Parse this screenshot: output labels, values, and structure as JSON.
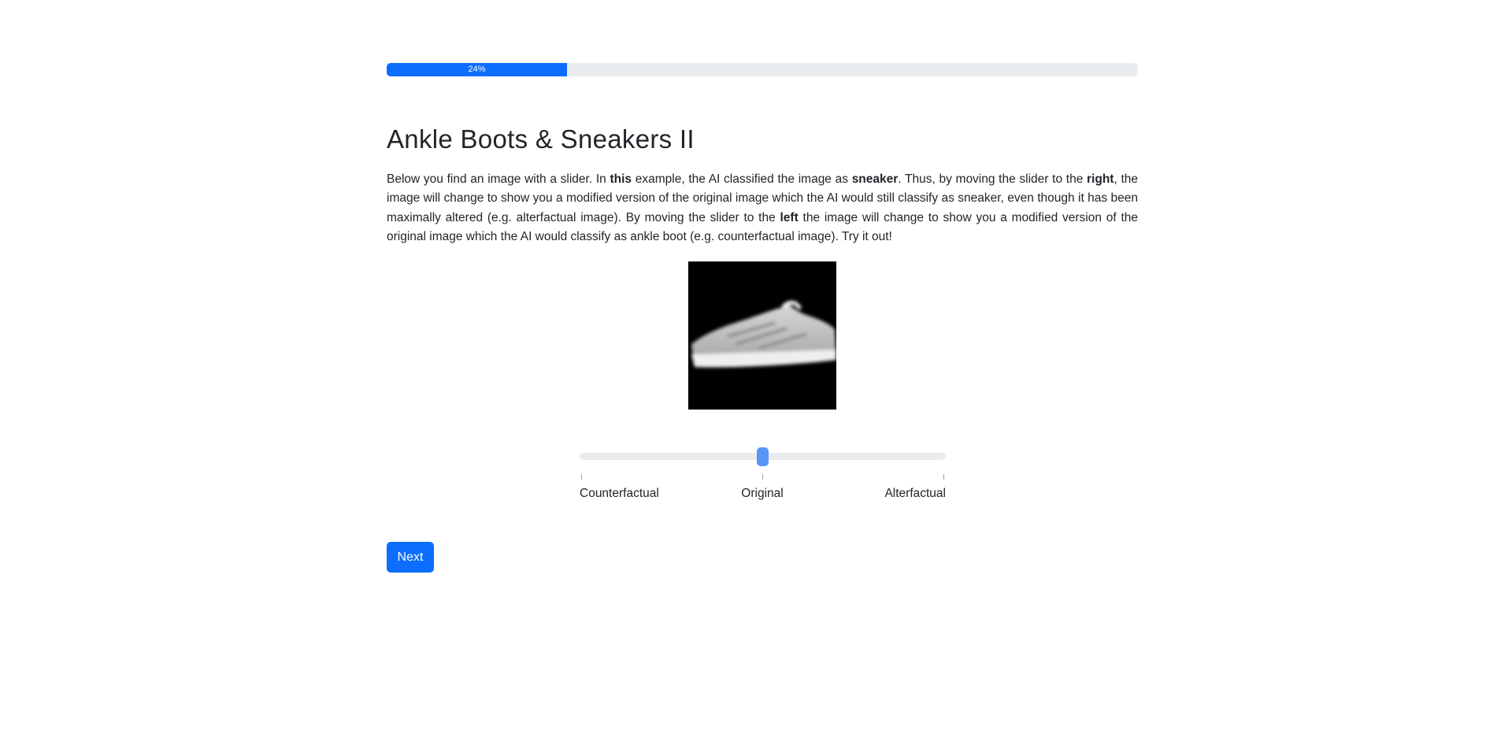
{
  "progress": {
    "value": 24,
    "label": "24%"
  },
  "page": {
    "title": "Ankle Boots & Sneakers II"
  },
  "description": {
    "p1": "Below you find an image with a slider. In ",
    "b1": "this",
    "p2": " example, the AI classified the image as ",
    "b2": "sneaker",
    "p3": ". Thus, by moving the slider to the ",
    "b3": "right",
    "p4": ", the image will change to show you a modified version of the original image which the AI would still classify as sneaker, even though it has been maximally altered (e.g. alterfactual image). By moving the slider to the ",
    "b4": "left",
    "p5": " the image will change to show you a modified version of the original image which the AI would classify as ankle boot (e.g. counterfactual image). Try it out!"
  },
  "image": {
    "icon": "sneaker-image"
  },
  "slider": {
    "labels": [
      "Counterfactual",
      "Original",
      "Alterfactual"
    ],
    "value": 0.5
  },
  "buttons": {
    "next_label": "Next"
  },
  "colors": {
    "primary": "#0d6efd",
    "track": "#e9ecef",
    "thumb": "#5a95f5"
  }
}
